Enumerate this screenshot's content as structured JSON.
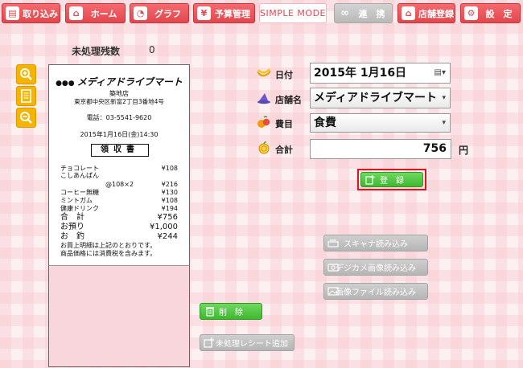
{
  "toolbar": {
    "receipt_import": "取り込み",
    "home": "ホーム",
    "graph": "グラフ",
    "budget": "予算管理",
    "simple_mode": "SIMPLE MODE",
    "link": "連　携",
    "store_register": "店舗登録",
    "settings": "設　定"
  },
  "unprocessed": {
    "label": "未処理残数",
    "count": "0"
  },
  "receipt": {
    "store_logo": "メディアドライブマート",
    "branch": "築地店",
    "address": "東京都中央区新富2丁目3番地4号",
    "phone": "電話：03-5541-9620",
    "datetime": "2015年1月16日(金)14:30",
    "title": "領収書",
    "items": [
      {
        "name": "チョコレート",
        "price": "¥108"
      },
      {
        "name": "こしあんぱん",
        "price": ""
      },
      {
        "name": "@108×2",
        "price": "¥216"
      },
      {
        "name": "コーヒー無糖",
        "price": "¥130"
      },
      {
        "name": "ミントガム",
        "price": "¥108"
      },
      {
        "name": "健康ドリンク",
        "price": "¥194"
      }
    ],
    "total_label": "合　計",
    "total_value": "¥756",
    "paid_label": "お預り",
    "paid_value": "¥1,000",
    "change_label": "お　釣",
    "change_value": "¥244",
    "note1": "お買上明細は上記のとおりです。",
    "note2": "商品価格には消費税を含みます。"
  },
  "form": {
    "date_label": "日付",
    "date_value": "2015年  1月16日",
    "store_label": "店舗名",
    "store_value": "メディアドライブマート",
    "category_label": "費目",
    "category_value": "食費",
    "total_label": "合計",
    "total_value": "756",
    "currency": "円"
  },
  "buttons": {
    "register": "登　録",
    "scanner": "スキャナ読み込み",
    "camera": "デジカメ画像読み込み",
    "image_file": "画像ファイル読み込み",
    "delete": "削　除",
    "add_unprocessed": "未処理レシート追加"
  },
  "colors": {
    "accent_red": "#e2474d",
    "register_highlight": "#e0141e",
    "tool_yellow": "#f4b400"
  }
}
